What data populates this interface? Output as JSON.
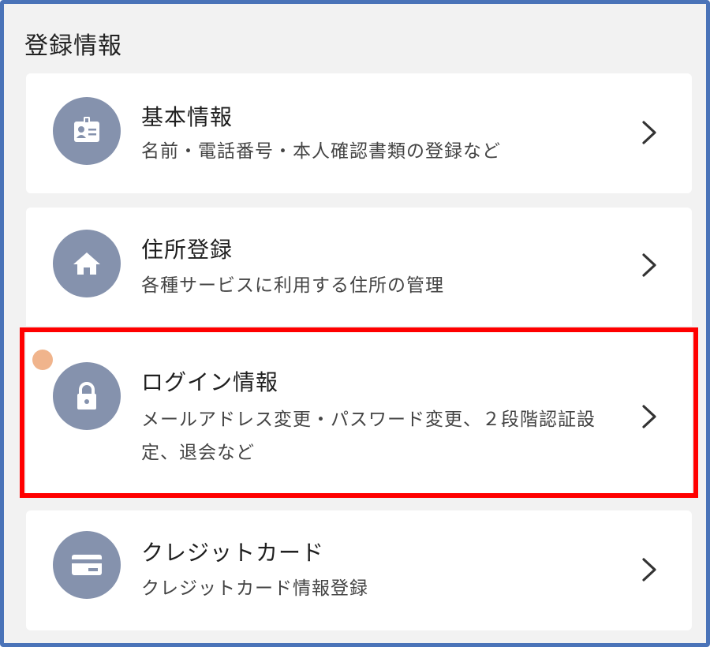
{
  "section": {
    "title": "登録情報"
  },
  "items": [
    {
      "title": "基本情報",
      "description": "名前・電話番号・本人確認書類の登録など",
      "icon": "id-card-icon"
    },
    {
      "title": "住所登録",
      "description": "各種サービスに利用する住所の管理",
      "icon": "home-icon"
    },
    {
      "title": "ログイン情報",
      "description": "メールアドレス変更・パスワード変更、２段階認証設定、退会など",
      "icon": "lock-icon"
    },
    {
      "title": "クレジットカード",
      "description": "クレジットカード情報登録",
      "icon": "credit-card-icon"
    }
  ],
  "colors": {
    "frame_border": "#4a73b8",
    "icon_bg": "#8592ad",
    "highlight": "#ff0000",
    "dot": "#f0b48c"
  }
}
